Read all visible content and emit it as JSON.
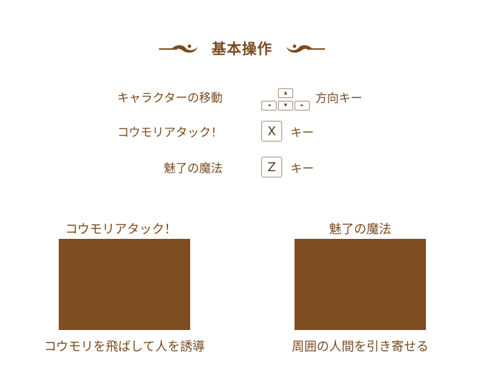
{
  "header": {
    "title": "基本操作"
  },
  "controls": [
    {
      "label": "キャラクターの移動",
      "key": "arrows",
      "suffix": "方向キー"
    },
    {
      "label": "コウモリアタック！",
      "key": "X",
      "suffix": "キー"
    },
    {
      "label": "魅了の魔法",
      "key": "Z",
      "suffix": "キー"
    }
  ],
  "arrow_glyphs": {
    "up": "▲",
    "down": "▼",
    "left": "◄",
    "right": "►"
  },
  "panels": [
    {
      "title": "コウモリアタック！",
      "caption": "コウモリを飛ばして人を誘導"
    },
    {
      "title": "魅了の魔法",
      "caption": "周囲の人間を引き寄せる"
    }
  ],
  "colors": {
    "text": "#7a4a1f",
    "panel_fill": "#7e4d22",
    "key_border": "#a08a74",
    "background": "#ffffff"
  }
}
